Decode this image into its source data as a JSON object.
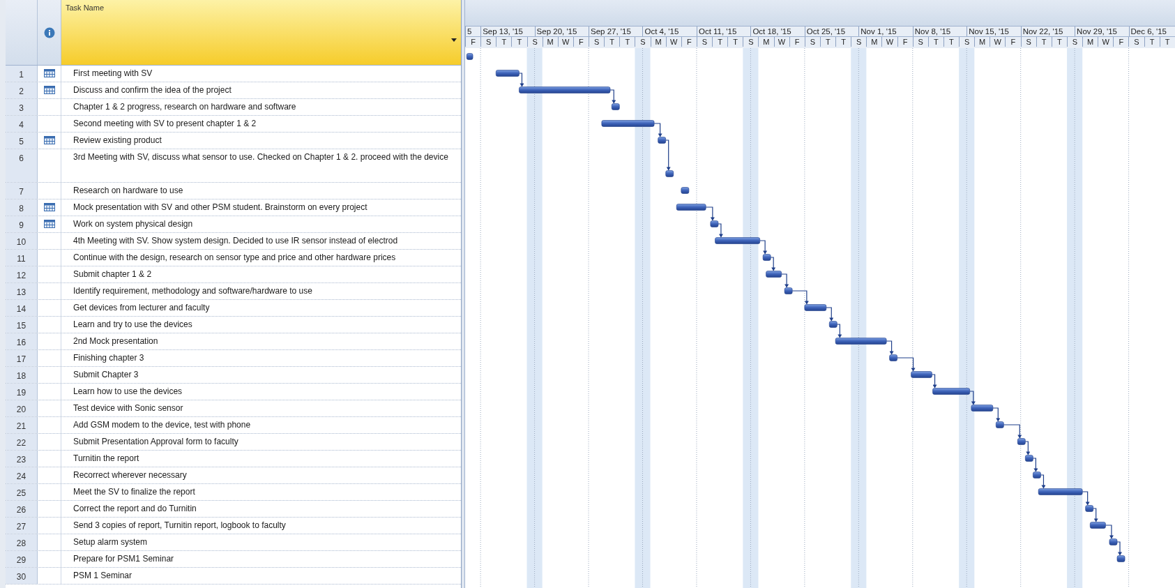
{
  "task_table": {
    "heading": "Task Name",
    "rows": [
      {
        "id": "1",
        "name": "First meeting with SV",
        "calendar_indicator": true
      },
      {
        "id": "2",
        "name": "Discuss and confirm the idea of the project",
        "calendar_indicator": true
      },
      {
        "id": "3",
        "name": "Chapter 1 & 2 progress, research on hardware and software",
        "calendar_indicator": false
      },
      {
        "id": "4",
        "name": "Second meeting with SV to present chapter 1 & 2",
        "calendar_indicator": false
      },
      {
        "id": "5",
        "name": "Review existing product",
        "calendar_indicator": true
      },
      {
        "id": "6",
        "name": "3rd Meeting with SV, discuss what sensor to use. Checked on Chapter 1 & 2. proceed with the device",
        "calendar_indicator": false
      },
      {
        "id": "7",
        "name": "Research on hardware to use",
        "calendar_indicator": false
      },
      {
        "id": "8",
        "name": "Mock presentation with SV and other PSM student. Brainstorm on every project",
        "calendar_indicator": true
      },
      {
        "id": "9",
        "name": "Work on system physical design",
        "calendar_indicator": true
      },
      {
        "id": "10",
        "name": "4th Meeting with SV. Show system design. Decided to use IR sensor instead of electrod",
        "calendar_indicator": false
      },
      {
        "id": "11",
        "name": "Continue with the design, research on sensor type and price and other hardware prices",
        "calendar_indicator": false
      },
      {
        "id": "12",
        "name": "Submit chapter 1 & 2",
        "calendar_indicator": false
      },
      {
        "id": "13",
        "name": "Identify requirement, methodology and software/hardware to use",
        "calendar_indicator": false
      },
      {
        "id": "14",
        "name": "Get devices from lecturer and faculty",
        "calendar_indicator": false
      },
      {
        "id": "15",
        "name": "Learn and try to use the devices",
        "calendar_indicator": false
      },
      {
        "id": "16",
        "name": "2nd Mock presentation",
        "calendar_indicator": false
      },
      {
        "id": "17",
        "name": "Finishing chapter 3",
        "calendar_indicator": false
      },
      {
        "id": "18",
        "name": "Submit Chapter 3",
        "calendar_indicator": false
      },
      {
        "id": "19",
        "name": "Learn how to use the devices",
        "calendar_indicator": false
      },
      {
        "id": "20",
        "name": "Test device with Sonic sensor",
        "calendar_indicator": false
      },
      {
        "id": "21",
        "name": "Add GSM modem to the device, test with phone",
        "calendar_indicator": false
      },
      {
        "id": "22",
        "name": "Submit Presentation Approval form to faculty",
        "calendar_indicator": false
      },
      {
        "id": "23",
        "name": "Turnitin the report",
        "calendar_indicator": false
      },
      {
        "id": "24",
        "name": "Recorrect wherever necessary",
        "calendar_indicator": false
      },
      {
        "id": "25",
        "name": "Meet the SV to finalize the report",
        "calendar_indicator": false
      },
      {
        "id": "26",
        "name": "Correct the report and do Turnitin",
        "calendar_indicator": false
      },
      {
        "id": "27",
        "name": "Send 3 copies of report, Turnitin report, logbook to faculty",
        "calendar_indicator": false
      },
      {
        "id": "28",
        "name": "Setup alarm system",
        "calendar_indicator": false
      },
      {
        "id": "29",
        "name": "Prepare for PSM1 Seminar",
        "calendar_indicator": false
      },
      {
        "id": "30",
        "name": "PSM 1 Seminar",
        "calendar_indicator": false
      }
    ]
  },
  "timescale": {
    "weeks": [
      "5",
      "Sep 13, '15",
      "Sep 20, '15",
      "Sep 27, '15",
      "Oct 4, '15",
      "Oct 11, '15",
      "Oct 18, '15",
      "Oct 25, '15",
      "Nov 1, '15",
      "Nov 8, '15",
      "Nov 15, '15",
      "Nov 22, '15",
      "Nov 29, '15",
      "Dec 6, '15"
    ],
    "days": [
      "F",
      "S",
      "T",
      "T",
      "S",
      "M",
      "W",
      "F",
      "S",
      "T",
      "T",
      "S",
      "M",
      "W",
      "F",
      "S",
      "T",
      "T",
      "S",
      "M",
      "W",
      "F",
      "S",
      "T",
      "T",
      "S",
      "M",
      "W",
      "F",
      "S",
      "T",
      "T",
      "S",
      "M",
      "W",
      "F",
      "S",
      "T",
      "T",
      "S",
      "M",
      "W",
      "F",
      "S",
      "T",
      "T"
    ]
  }
}
